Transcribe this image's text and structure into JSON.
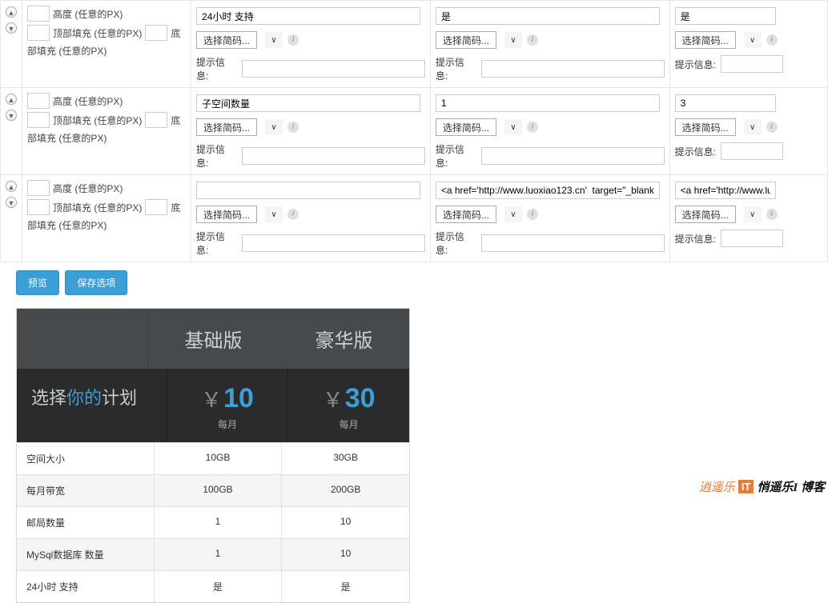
{
  "style_labels": {
    "height": "高度 (任意的PX)",
    "top_pad": "顶部填充 (任意的PX)",
    "bottom_suffix": "底",
    "side_pad": "部填充 (任意的PX)"
  },
  "shortcode": {
    "dropdown_label": "选择简码...",
    "hint_label": "提示信息:"
  },
  "rows": [
    {
      "c1_value": "24小时 支持",
      "c2_value": "是",
      "c3_value": "是"
    },
    {
      "c1_value": "子空间数量",
      "c2_value": "1",
      "c3_value": "3"
    },
    {
      "c1_value": "",
      "c2_value": "<a href='http://www.luoxiao123.cn'  target=\"_blank",
      "c3_value": "<a href='http://www.luoxia"
    }
  ],
  "buttons": {
    "preview": "预览",
    "save": "保存选项"
  },
  "pricing": {
    "plan1": "基础版",
    "plan2": "豪华版",
    "choose_a": "选择",
    "choose_b": "你的",
    "choose_c": "计划",
    "currency": "￥",
    "price1": "10",
    "price2": "30",
    "per": "每月",
    "features": [
      {
        "label": "空间大小",
        "v1": "10GB",
        "v2": "30GB"
      },
      {
        "label": "每月带宽",
        "v1": "100GB",
        "v2": "200GB"
      },
      {
        "label": "邮局数量",
        "v1": "1",
        "v2": "10"
      },
      {
        "label": "MySql数据库 数量",
        "v1": "1",
        "v2": "10"
      },
      {
        "label": "24小时 支持",
        "v1": "是",
        "v2": "是"
      }
    ]
  },
  "watermark": {
    "a": "逍遥乐",
    "it": "IT",
    "b": "悄遥乐I 博客"
  }
}
